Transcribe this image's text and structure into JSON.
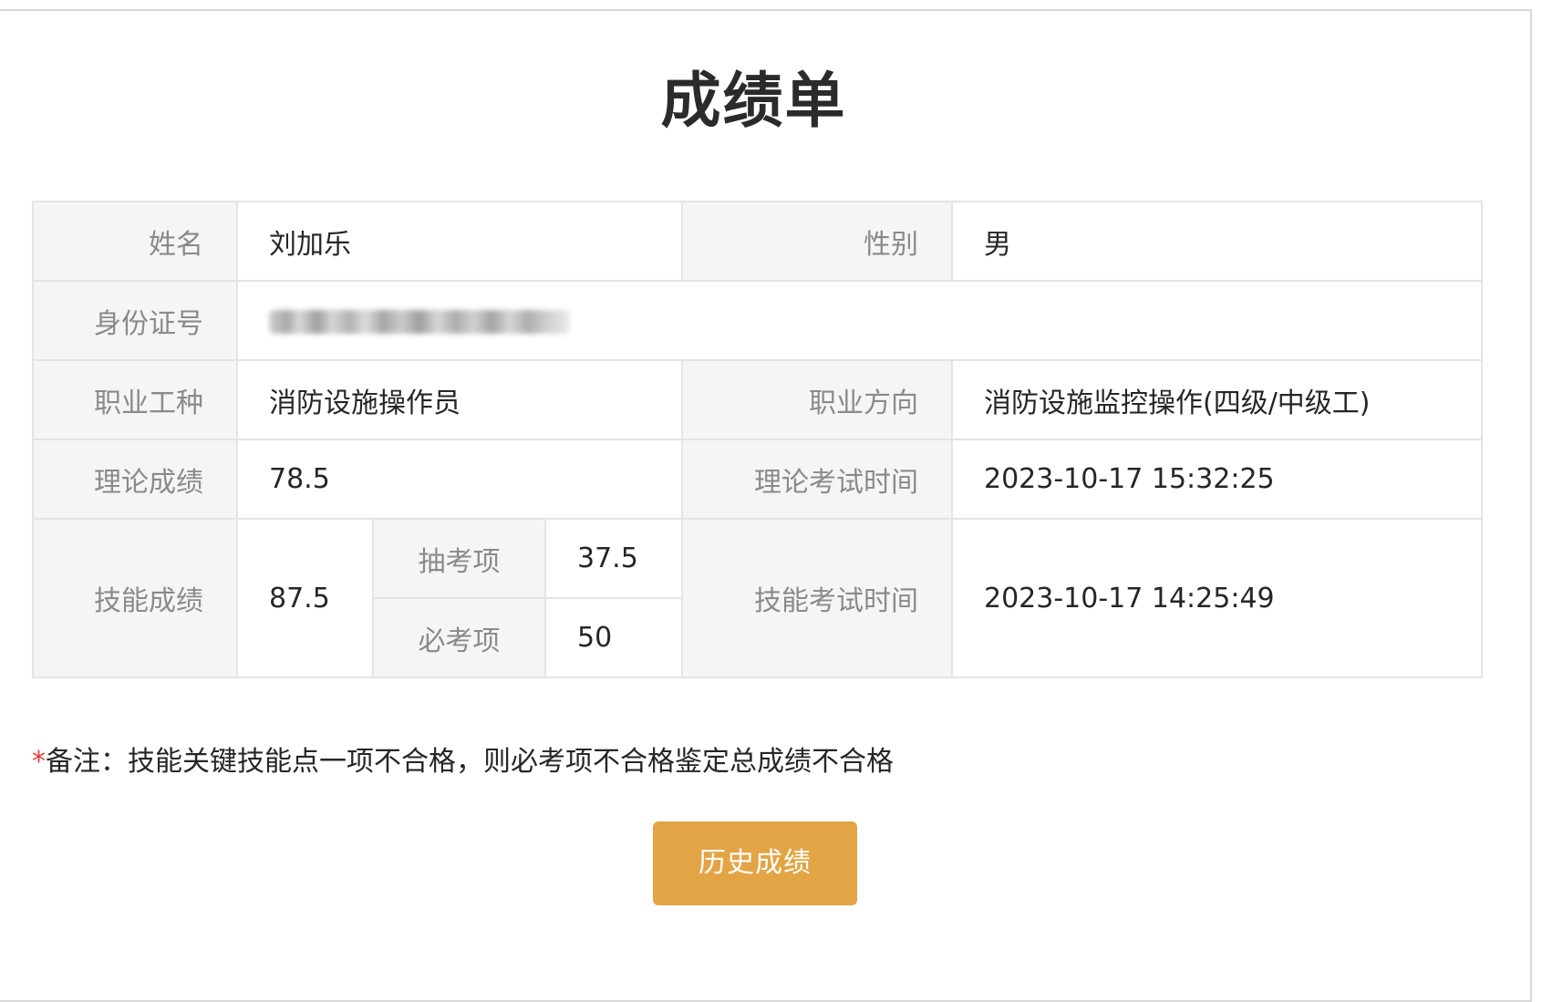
{
  "page": {
    "title": "成绩单"
  },
  "table": {
    "name_label": "姓名",
    "name_value": "刘加乐",
    "gender_label": "性别",
    "gender_value": "男",
    "id_label": "身份证号",
    "occupation_label": "职业工种",
    "occupation_value": "消防设施操作员",
    "direction_label": "职业方向",
    "direction_value": "消防设施监控操作(四级/中级工)",
    "theory_score_label": "理论成绩",
    "theory_score_value": "78.5",
    "theory_time_label": "理论考试时间",
    "theory_time_value": "2023-10-17 15:32:25",
    "skill_score_label": "技能成绩",
    "skill_score_value": "87.5",
    "random_item_label": "抽考项",
    "random_item_value": "37.5",
    "required_item_label": "必考项",
    "required_item_value": "50",
    "skill_time_label": "技能考试时间",
    "skill_time_value": "2023-10-17 14:25:49"
  },
  "note": {
    "star": "*",
    "text": "备注：技能关键技能点一项不合格，则必考项不合格鉴定总成绩不合格"
  },
  "history_button": {
    "label": "历史成绩"
  },
  "colors": {
    "button_bg": "#e3a445",
    "label_bg": "#f5f5f5",
    "label_text": "#8a8a8a",
    "accent_blue": "#4a8ed0",
    "required_star": "#e03b3b"
  }
}
